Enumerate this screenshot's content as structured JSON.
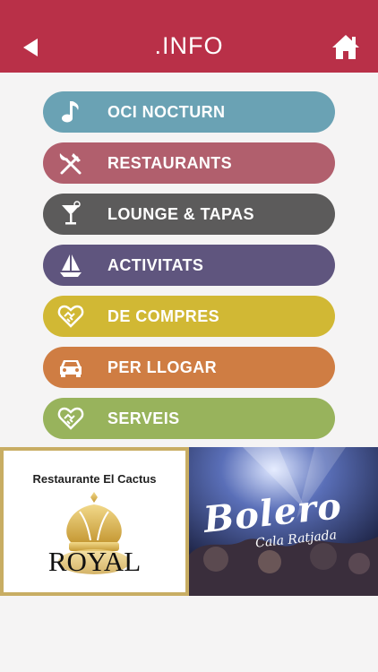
{
  "header": {
    "title": ".INFO",
    "back_icon": "back-arrow-icon",
    "home_icon": "home-icon",
    "color": "#b93048"
  },
  "menu": [
    {
      "label": "OCI NOCTURN",
      "icon": "music-note-icon",
      "color": "#6aa2b4"
    },
    {
      "label": "RESTAURANTS",
      "icon": "fork-knife-icon",
      "color": "#b15f6d"
    },
    {
      "label": "LOUNGE & TAPAS",
      "icon": "cocktail-icon",
      "color": "#5c5b5b"
    },
    {
      "label": "ACTIVITATS",
      "icon": "sailboat-icon",
      "color": "#5f557e"
    },
    {
      "label": "DE COMPRES",
      "icon": "heart-handshake-icon",
      "color": "#d1b834"
    },
    {
      "label": "PER LLOGAR",
      "icon": "car-icon",
      "color": "#cf7d43"
    },
    {
      "label": "SERVEIS",
      "icon": "heart-handshake-icon",
      "color": "#98b35c"
    }
  ],
  "ads": {
    "left": {
      "caption": "Restaurante El Cactus",
      "brand": "ROYAL"
    },
    "right": {
      "brand": "Bolero",
      "sub": "Cala Ratjada"
    }
  }
}
